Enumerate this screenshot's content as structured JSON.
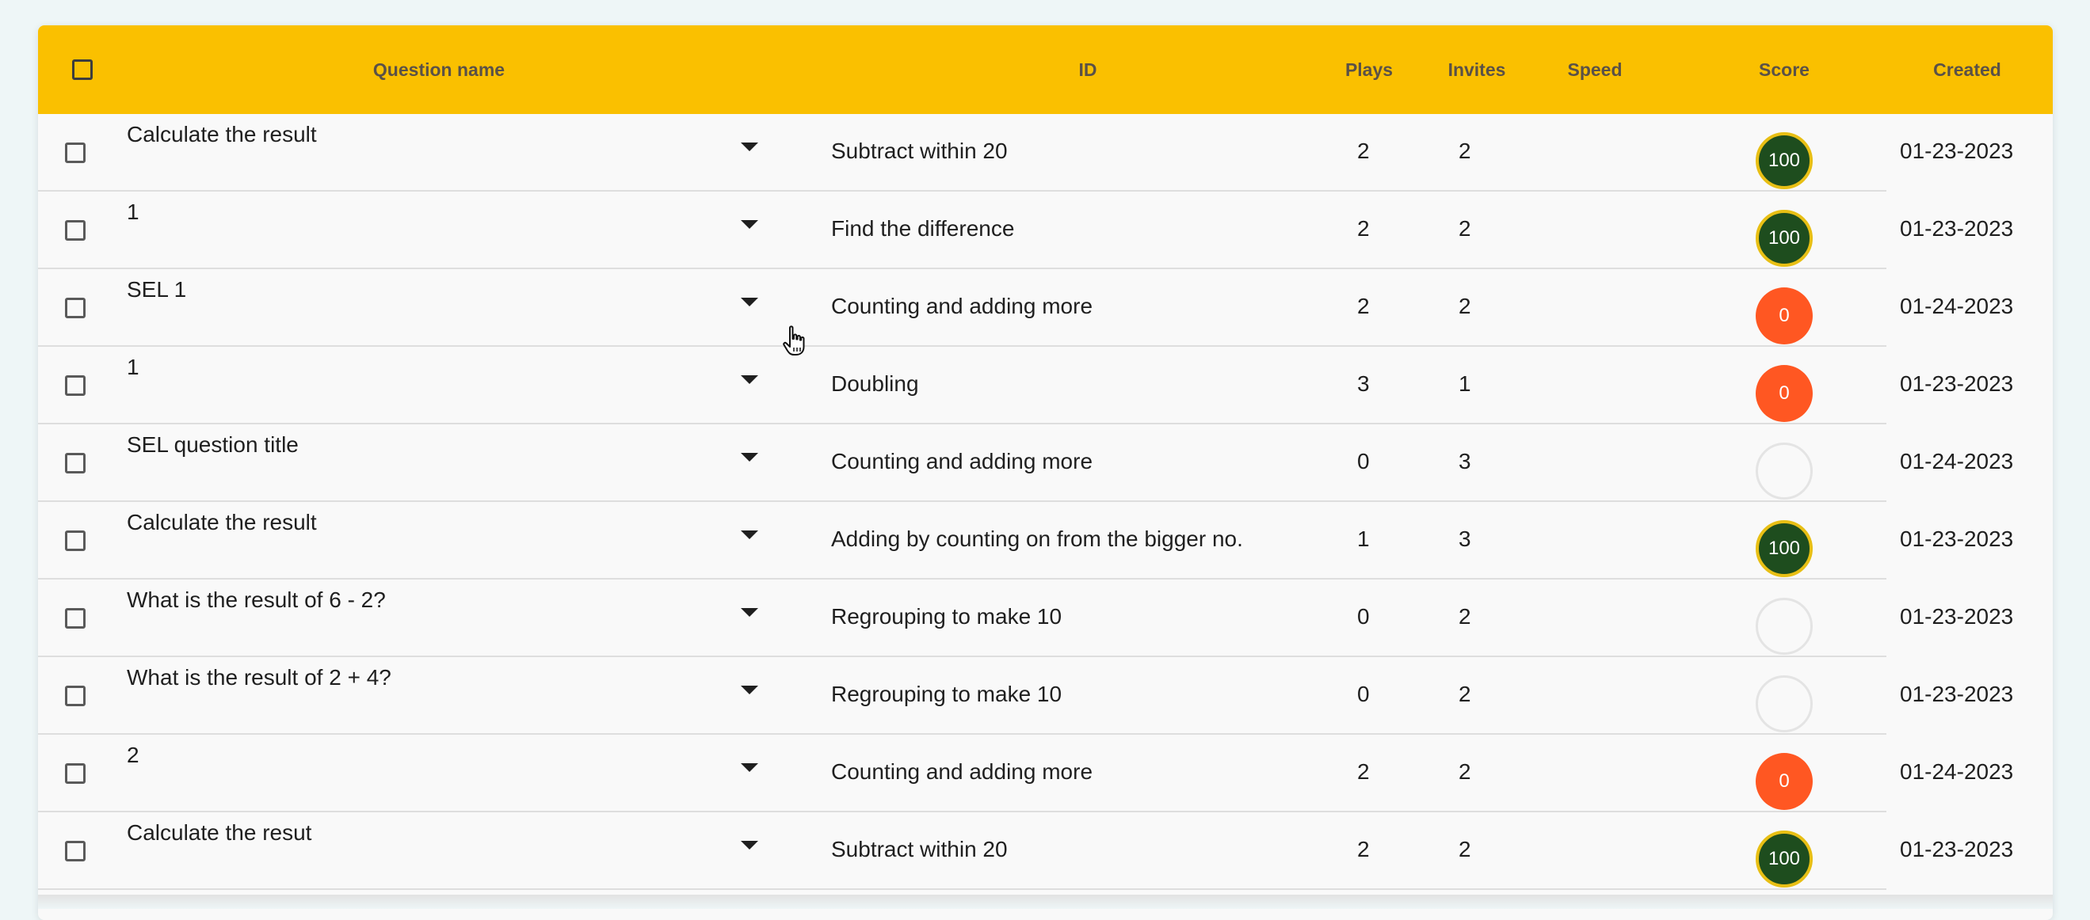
{
  "header": {
    "question_name": "Question name",
    "id": "ID",
    "plays": "Plays",
    "invites": "Invites",
    "speed": "Speed",
    "score": "Score",
    "created": "Created"
  },
  "rows": [
    {
      "question": "Calculate the result",
      "id": "Subtract within 20",
      "plays": "2",
      "invites": "2",
      "score": "100",
      "score_state": "full",
      "created": "01-23-2023"
    },
    {
      "question": "1",
      "id": "Find the difference",
      "plays": "2",
      "invites": "2",
      "score": "100",
      "score_state": "full",
      "created": "01-23-2023"
    },
    {
      "question": "SEL 1",
      "id": "Counting and adding more",
      "plays": "2",
      "invites": "2",
      "score": "0",
      "score_state": "zero",
      "created": "01-24-2023"
    },
    {
      "question": "1",
      "id": "Doubling",
      "plays": "3",
      "invites": "1",
      "score": "0",
      "score_state": "zero",
      "created": "01-23-2023"
    },
    {
      "question": "SEL question title",
      "id": "Counting and adding more",
      "plays": "0",
      "invites": "3",
      "score": "",
      "score_state": "empty",
      "created": "01-24-2023"
    },
    {
      "question": "Calculate the result",
      "id": "Adding by counting on from the bigger no.",
      "plays": "1",
      "invites": "3",
      "score": "100",
      "score_state": "full",
      "created": "01-23-2023"
    },
    {
      "question": "What is the result of 6 - 2?",
      "id": "Regrouping to make 10",
      "plays": "0",
      "invites": "2",
      "score": "",
      "score_state": "empty",
      "created": "01-23-2023"
    },
    {
      "question": "What is the result of 2 + 4?",
      "id": "Regrouping to make 10",
      "plays": "0",
      "invites": "2",
      "score": "",
      "score_state": "empty",
      "created": "01-23-2023"
    },
    {
      "question": "2",
      "id": "Counting and adding more",
      "plays": "2",
      "invites": "2",
      "score": "0",
      "score_state": "zero",
      "created": "01-24-2023"
    },
    {
      "question": "Calculate the resut",
      "id": "Subtract within 20",
      "plays": "2",
      "invites": "2",
      "score": "100",
      "score_state": "full",
      "created": "01-23-2023"
    }
  ],
  "colors": {
    "header_bg": "#fac000",
    "score_full": "#1e4d1e",
    "score_full_ring": "#e8bf14",
    "score_zero": "#ff5722"
  },
  "icons": {
    "row_menu": "caret-down-icon",
    "cursor": "hand-pointer-cursor-icon"
  }
}
